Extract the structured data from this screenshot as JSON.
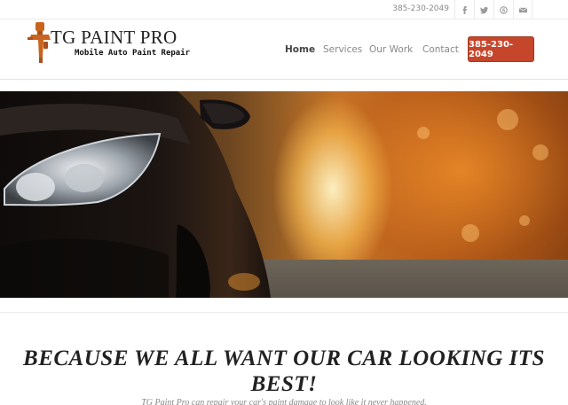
{
  "topbar": {
    "phone": "385-230-2049",
    "social": [
      "facebook-icon",
      "twitter-icon",
      "skype-icon",
      "mail-icon"
    ]
  },
  "logo": {
    "title": "TG PAINT PRO",
    "subtitle": "Mobile Auto Paint Repair"
  },
  "nav": {
    "items": [
      "Home",
      "Services",
      "Our Work",
      "Contact"
    ],
    "active": "Home",
    "cta_label": "385-230-2049"
  },
  "colors": {
    "cta": "#c6462b",
    "logo_orange": "#c8641e"
  },
  "hero": {
    "image": "black-car-headlight-autumn-road"
  },
  "content": {
    "headline": "BECAUSE WE ALL WANT OUR CAR LOOKING ITS BEST!",
    "subline": "TG Paint Pro can repair your car's paint damage to look like it never happened."
  }
}
